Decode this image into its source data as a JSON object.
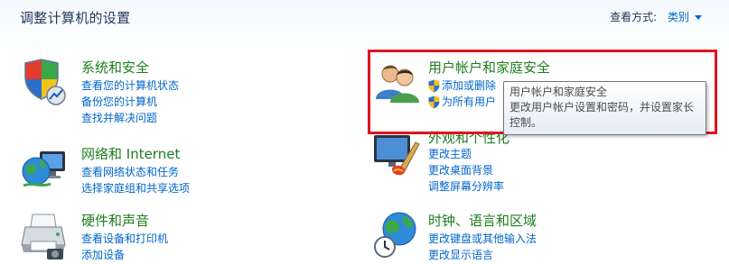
{
  "header": {
    "title": "调整计算机的设置",
    "view_by_label": "查看方式:",
    "view_by_value": "类别"
  },
  "categories": [
    {
      "title": "系统和安全",
      "links": [
        "查看您的计算机状态",
        "备份您的计算机",
        "查找并解决问题"
      ]
    },
    {
      "title": "网络和 Internet",
      "links": [
        "查看网络状态和任务",
        "选择家庭组和共享选项"
      ]
    },
    {
      "title": "硬件和声音",
      "links": [
        "查看设备和打印机",
        "添加设备"
      ]
    },
    {
      "title": "用户帐户和家庭安全",
      "links": [
        "添加或删除",
        "为所有用户"
      ]
    },
    {
      "title": "外观和个性化",
      "links": [
        "更改主题",
        "更改桌面背景",
        "调整屏幕分辨率"
      ]
    },
    {
      "title": "时钟、语言和区域",
      "links": [
        "更改键盘或其他输入法",
        "更改显示语言"
      ]
    }
  ],
  "tooltip": {
    "title": "用户帐户和家庭安全",
    "description": "更改用户帐户设置和密码，并设置家长控制。"
  },
  "icons": {
    "system_security": "shield-chart-icon",
    "network": "globe-computer-icon",
    "hardware": "printer-icon",
    "user_accounts": "users-icon",
    "appearance": "monitor-paint-icon",
    "clock_region": "globe-clock-icon",
    "uac": "uac-shield-icon"
  },
  "colors": {
    "category_title": "#1e7e1e",
    "link": "#0066cc",
    "highlight": "#e0141e"
  }
}
